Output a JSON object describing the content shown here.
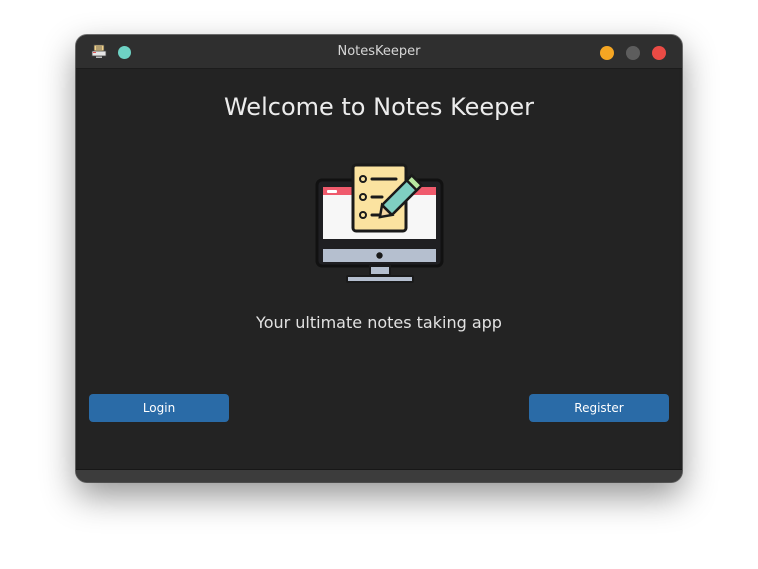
{
  "window": {
    "title": "NotesKeeper"
  },
  "main": {
    "heading": "Welcome to Notes Keeper",
    "tagline": "Your ultimate notes taking app",
    "illustration": "notes-monitor-icon"
  },
  "buttons": {
    "login_label": "Login",
    "register_label": "Register"
  },
  "icons": {
    "app": "app-icon",
    "pin": "pin-icon",
    "minimize": "minimize-icon",
    "maximize": "maximize-icon",
    "close": "close-icon"
  },
  "colors": {
    "background": "#232323",
    "titlebar": "#2f2f2f",
    "button": "#2a6ba7",
    "pin": "#6ed2c4",
    "minimize": "#f5a623",
    "maximize": "#5d5d5d",
    "close": "#ea4b45"
  }
}
